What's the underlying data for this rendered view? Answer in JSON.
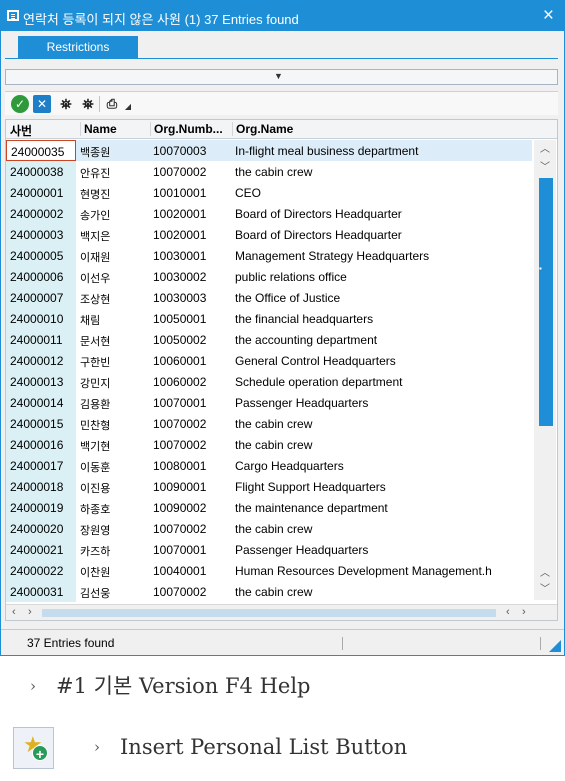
{
  "window": {
    "title": "연락처 등록이 되지 않은 사원 (1)   37 Entries found",
    "close_label": "×"
  },
  "tabs": [
    {
      "label": "Restrictions"
    }
  ],
  "columns": {
    "pernr": "사번",
    "name": "Name",
    "orgnum": "Org.Numb...",
    "orgname": "Org.Name"
  },
  "rows": [
    {
      "pernr": "24000035",
      "name": "백종원",
      "orgnum": "10070003",
      "orgname": "In-flight meal business department"
    },
    {
      "pernr": "24000038",
      "name": "안유진",
      "orgnum": "10070002",
      "orgname": "the cabin crew"
    },
    {
      "pernr": "24000001",
      "name": "현명진",
      "orgnum": "10010001",
      "orgname": "CEO"
    },
    {
      "pernr": "24000002",
      "name": "송가인",
      "orgnum": "10020001",
      "orgname": "Board of Directors Headquarter"
    },
    {
      "pernr": "24000003",
      "name": "백지은",
      "orgnum": "10020001",
      "orgname": "Board of Directors Headquarter"
    },
    {
      "pernr": "24000005",
      "name": "이재원",
      "orgnum": "10030001",
      "orgname": "Management Strategy Headquarters"
    },
    {
      "pernr": "24000006",
      "name": "이선우",
      "orgnum": "10030002",
      "orgname": "public relations office"
    },
    {
      "pernr": "24000007",
      "name": "조상현",
      "orgnum": "10030003",
      "orgname": "the Office of Justice"
    },
    {
      "pernr": "24000010",
      "name": "채림",
      "orgnum": "10050001",
      "orgname": "the financial headquarters"
    },
    {
      "pernr": "24000011",
      "name": "문서현",
      "orgnum": "10050002",
      "orgname": "the accounting department"
    },
    {
      "pernr": "24000012",
      "name": "구한빈",
      "orgnum": "10060001",
      "orgname": "General Control Headquarters"
    },
    {
      "pernr": "24000013",
      "name": "강민지",
      "orgnum": "10060002",
      "orgname": "Schedule operation department"
    },
    {
      "pernr": "24000014",
      "name": "김용환",
      "orgnum": "10070001",
      "orgname": "Passenger Headquarters"
    },
    {
      "pernr": "24000015",
      "name": "민찬형",
      "orgnum": "10070002",
      "orgname": "the cabin crew"
    },
    {
      "pernr": "24000016",
      "name": "백기현",
      "orgnum": "10070002",
      "orgname": "the cabin crew"
    },
    {
      "pernr": "24000017",
      "name": "이동훈",
      "orgnum": "10080001",
      "orgname": "Cargo Headquarters"
    },
    {
      "pernr": "24000018",
      "name": "이진용",
      "orgnum": "10090001",
      "orgname": "Flight Support Headquarters"
    },
    {
      "pernr": "24000019",
      "name": "하종호",
      "orgnum": "10090002",
      "orgname": "the maintenance department"
    },
    {
      "pernr": "24000020",
      "name": "장원영",
      "orgnum": "10070002",
      "orgname": "the cabin crew"
    },
    {
      "pernr": "24000021",
      "name": "카즈하",
      "orgnum": "10070001",
      "orgname": "Passenger Headquarters"
    },
    {
      "pernr": "24000022",
      "name": "이찬원",
      "orgnum": "10040001",
      "orgname": "Human Resources Development Management.h"
    },
    {
      "pernr": "24000031",
      "name": "김선웅",
      "orgnum": "10070002",
      "orgname": "the cabin crew"
    }
  ],
  "status": {
    "text": "37 Entries found"
  },
  "notes": {
    "help_version": "#1 기본 Version F4 Help",
    "insert_button": "Insert Personal List Button",
    "chevron": "›"
  },
  "icons": {
    "accept": "check-icon",
    "cancel": "cancel-icon",
    "find": "binoculars-icon",
    "find_next": "binoculars-plus-icon",
    "print": "printer-icon"
  },
  "colors": {
    "accent": "#1e8fd6",
    "key_column_bg": "#daf0f4",
    "selection_border": "#cc4422"
  }
}
